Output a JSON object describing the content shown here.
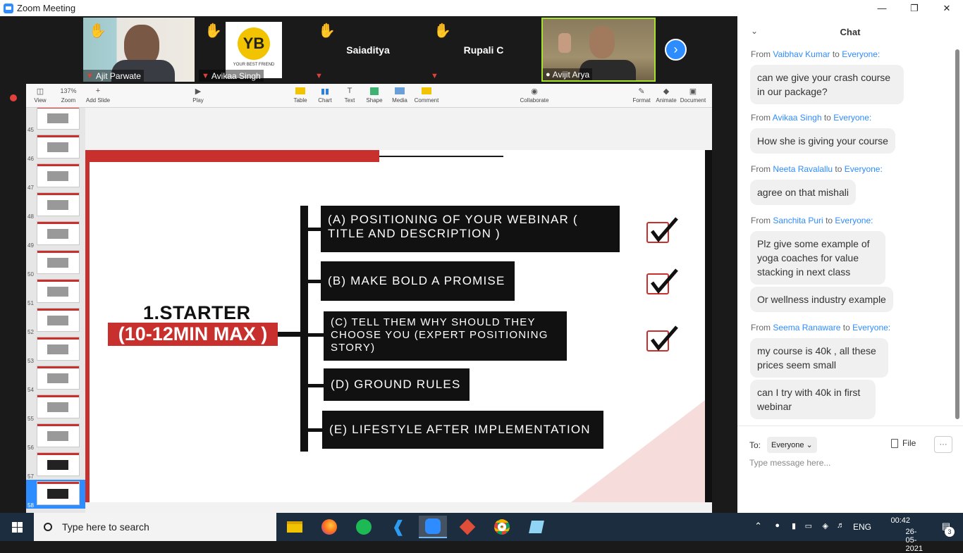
{
  "window": {
    "title": "Zoom Meeting"
  },
  "participants": [
    {
      "name": "Ajit Parwate",
      "muted": true,
      "video": true
    },
    {
      "name": "Avikaa Singh",
      "muted": true,
      "logo_text": "YOUR BEST FRIEND"
    },
    {
      "name": "Saiaditya",
      "muted": true
    },
    {
      "name": "Rupali C",
      "muted": true
    },
    {
      "name": "Avijit Arya",
      "muted": false,
      "video": true
    }
  ],
  "presentation": {
    "toolbar": {
      "view": "View",
      "zoom_value": "137%",
      "zoom": "Zoom",
      "add_slide": "Add Slide",
      "play": "Play",
      "table": "Table",
      "chart": "Chart",
      "text": "Text",
      "shape": "Shape",
      "media": "Media",
      "comment": "Comment",
      "collaborate": "Collaborate",
      "format": "Format",
      "animate": "Animate",
      "document": "Document"
    },
    "thumbnails": [
      "45",
      "46",
      "47",
      "48",
      "49",
      "50",
      "51",
      "52",
      "53",
      "54",
      "55",
      "56",
      "57",
      "58"
    ],
    "active_slide": "58",
    "slide": {
      "title": "1.STARTER",
      "subtitle": "(10-12MIN MAX )",
      "items": [
        {
          "line1": "(A) POSITIONING OF YOUR WEBINAR (",
          "line2": "TITLE AND DESCRIPTION )",
          "checked": true
        },
        {
          "line1": "(B) MAKE BOLD A PROMISE",
          "line2": "",
          "checked": true
        },
        {
          "line1": "(C) TELL THEM WHY SHOULD THEY",
          "line2": "CHOOSE YOU (EXPERT POSITIONING",
          "line3": "STORY)",
          "checked": true
        },
        {
          "line1": "(D) GROUND RULES",
          "line2": "",
          "checked": false
        },
        {
          "line1": "(E) LIFESTYLE  AFTER IMPLEMENTATION",
          "line2": "",
          "checked": false
        }
      ]
    }
  },
  "chat": {
    "header": "Chat",
    "from_word": "From",
    "to_word": "to",
    "everyone": "Everyone:",
    "messages": [
      {
        "from": "Vaibhav Kumar",
        "texts": [
          "can we give your crash course in our package?"
        ]
      },
      {
        "from": "Avikaa Singh",
        "texts": [
          "How she is giving your course"
        ]
      },
      {
        "from": "Neeta Ravalallu",
        "texts": [
          "agree on that mishali"
        ]
      },
      {
        "from": "Sanchita Puri",
        "texts": [
          "Plz give some example of yoga coaches for value stacking in next class",
          "Or wellness industry example"
        ]
      },
      {
        "from": "Seema Ranaware",
        "texts": [
          "my course is 40k , all these prices seem small",
          "can I try with 40k in first webinar"
        ]
      }
    ],
    "to_label": "To:",
    "to_value": "Everyone",
    "file_label": "File",
    "more_label": "···",
    "input_placeholder": "Type message here..."
  },
  "taskbar": {
    "search_placeholder": "Type here to search",
    "lang": "ENG",
    "time": "00:42",
    "date": "26-05-2021",
    "notifications": "3"
  }
}
